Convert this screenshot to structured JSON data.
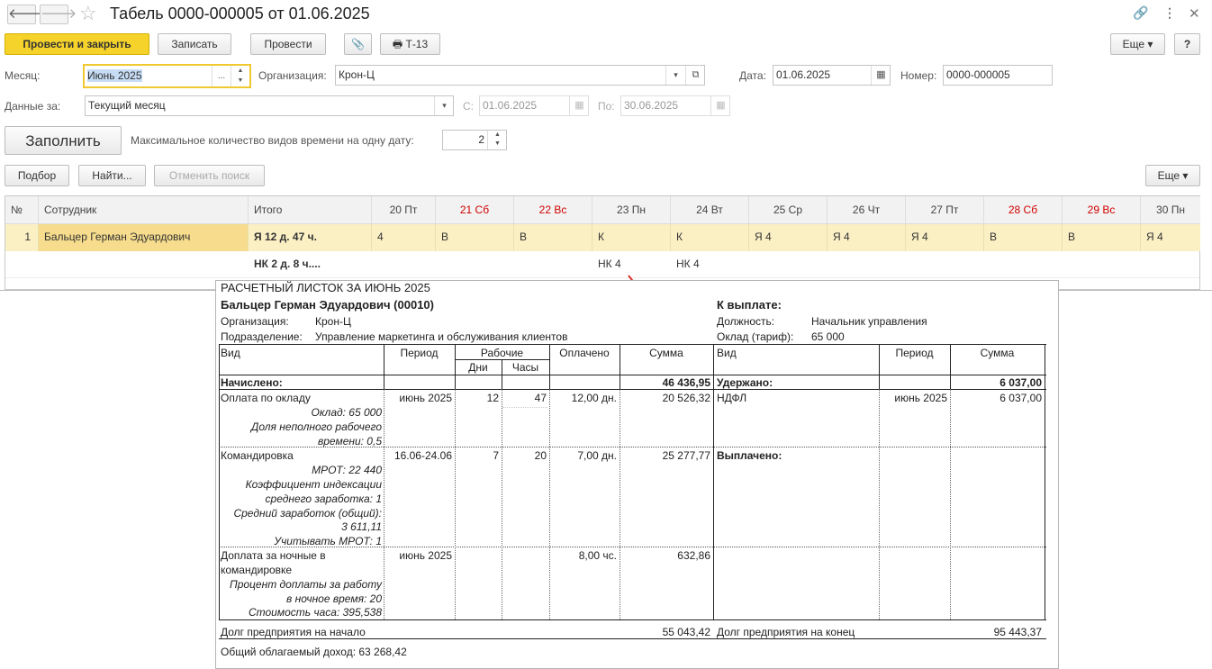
{
  "window": {
    "title": "Табель 0000-000005 от 01.06.2025",
    "toolbar": {
      "post_close": "Провести и закрыть",
      "write": "Записать",
      "post": "Провести",
      "t13": "Т-13",
      "more": "Еще",
      "help": "?"
    },
    "form": {
      "month_label": "Месяц:",
      "month_value": "Июнь 2025",
      "org_label": "Организация:",
      "org_value": "Крон-Ц",
      "date_label": "Дата:",
      "date_value": "01.06.2025",
      "number_label": "Номер:",
      "number_value": "0000-000005",
      "data_for_label": "Данные за:",
      "data_for_value": "Текущий месяц",
      "from_label": "С:",
      "from_value": "01.06.2025",
      "to_label": "По:",
      "to_value": "30.06.2025",
      "fill_button": "Заполнить",
      "max_types_label": "Максимальное количество видов времени на одну дату:",
      "max_types_value": "2"
    },
    "grid_toolbar": {
      "pick": "Подбор",
      "find": "Найти...",
      "cancel_search": "Отменить поиск",
      "more": "Еще"
    },
    "grid": {
      "headers": [
        "№",
        "Сотрудник",
        "Итого",
        "20 Пт",
        "21 Сб",
        "22 Вс",
        "23 Пн",
        "24 Вт",
        "25 Ср",
        "26 Чт",
        "27 Пт",
        "28 Сб",
        "29 Вс",
        "30 Пн"
      ],
      "row1": [
        "1",
        "Бальцер Герман Эдуардович",
        "Я 12 д. 47 ч.",
        "4",
        "В",
        "В",
        "К",
        "К",
        "Я 4",
        "Я 4",
        "Я 4",
        "В",
        "В",
        "Я 4"
      ],
      "row2": [
        "НК 2 д. 8 ч....",
        "НК 4",
        "НК 4"
      ]
    }
  },
  "payslip": {
    "title": "РАСЧЕТНЫЙ ЛИСТОК ЗА ИЮНЬ 2025",
    "employee": "Бальцер Герман Эдуардович (00010)",
    "to_pay": "К выплате:",
    "org_label": "Организация:",
    "org_value": "Крон-Ц",
    "dept_label": "Подразделение:",
    "dept_value": "Управление маркетинга и обслуживания клиентов",
    "position_label": "Должность:",
    "position_value": "Начальник управления",
    "salary_label": "Оклад (тариф):",
    "salary_value": "65 000",
    "headers": {
      "kind": "Вид",
      "period": "Период",
      "working": "Рабочие",
      "days": "Дни",
      "hours": "Часы",
      "paid": "Оплачено",
      "sum": "Сумма",
      "kind2": "Вид",
      "period2": "Период",
      "sum2": "Сумма"
    },
    "accrued_label": "Начислено:",
    "accrued_total": "46 436,95",
    "withheld_label": "Удержано:",
    "withheld_total": "6 037,00",
    "rows": [
      {
        "name": "Оплата по окладу",
        "period": "июнь 2025",
        "days": "12",
        "hours": "47",
        "paid": "12,00 дн.",
        "sum": "20 526,32",
        "notes": [
          "Оклад: 65 000",
          "Доля неполного рабочего",
          "времени: 0,5"
        ]
      },
      {
        "name": "Командировка",
        "period": "16.06-24.06",
        "days": "7",
        "hours": "20",
        "paid": "7,00 дн.",
        "sum": "25 277,77",
        "notes": [
          "МРОТ: 22 440",
          "Коэффициент индексации",
          "среднего заработка: 1",
          "Средний заработок (общий):",
          "3 611,11",
          "Учитывать МРОТ: 1"
        ]
      },
      {
        "name": "Доплата за ночные в",
        "name2": "командировке",
        "period": "июнь 2025",
        "days": "",
        "hours": "",
        "paid": "8,00 чс.",
        "sum": "632,86",
        "notes": [
          "Процент доплаты за работу",
          "в ночное время: 20",
          "Стоимость часа: 395,538"
        ]
      }
    ],
    "ndfl": {
      "name": "НДФЛ",
      "period": "июнь 2025",
      "sum": "6 037,00"
    },
    "paid_out_label": "Выплачено:",
    "debt_start_label": "Долг предприятия на начало",
    "debt_start_value": "55 043,42",
    "debt_end_label": "Долг предприятия на конец",
    "debt_end_value": "95 443,37",
    "taxable_income": "Общий облагаемый доход: 63 268,42"
  }
}
